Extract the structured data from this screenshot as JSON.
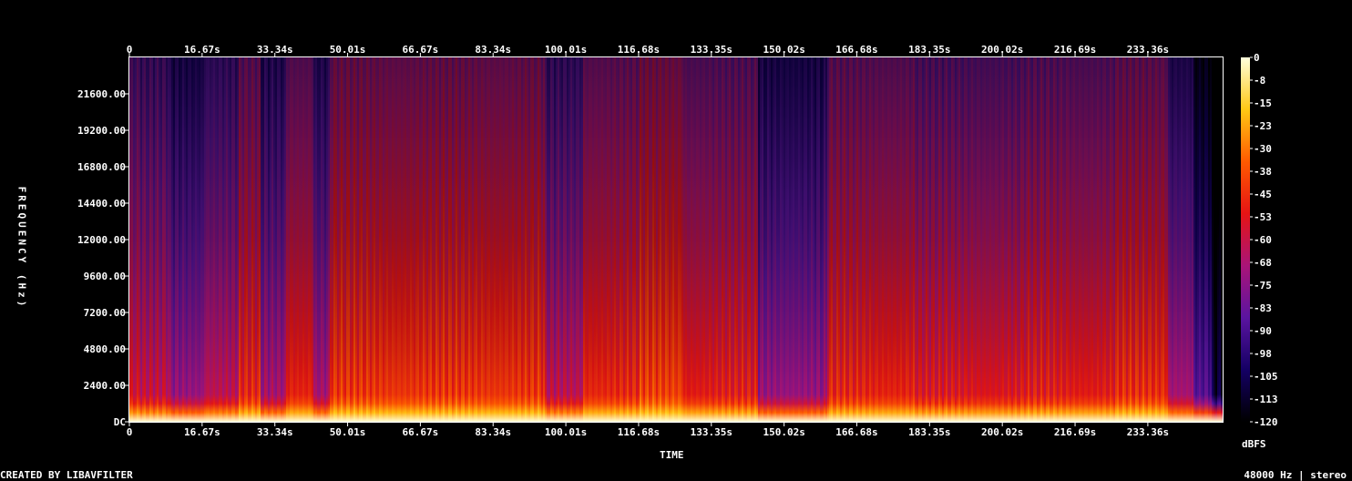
{
  "chart_data": {
    "type": "heatmap",
    "title": "",
    "xlabel": "TIME",
    "ylabel": "FREQUENCY (Hz)",
    "colorbar_label": "dBFS",
    "x_ticks": [
      "0",
      "16.67s",
      "33.34s",
      "50.01s",
      "66.67s",
      "83.34s",
      "100.01s",
      "116.68s",
      "133.35s",
      "150.02s",
      "166.68s",
      "183.35s",
      "200.02s",
      "216.69s",
      "233.36s"
    ],
    "x_tick_values": [
      0,
      16.67,
      33.34,
      50.01,
      66.67,
      83.34,
      100.01,
      116.68,
      133.35,
      150.02,
      166.68,
      183.35,
      200.02,
      216.69,
      233.36
    ],
    "xlim": [
      0,
      250.5
    ],
    "y_ticks": [
      "DC",
      "2400.00",
      "4800.00",
      "7200.00",
      "9600.00",
      "12000.00",
      "14400.00",
      "16800.00",
      "19200.00",
      "21600.00"
    ],
    "y_tick_values": [
      0,
      2400,
      4800,
      7200,
      9600,
      12000,
      14400,
      16800,
      19200,
      21600
    ],
    "ylim": [
      0,
      24000
    ],
    "colorbar_ticks": [
      "0",
      "-8",
      "-15",
      "-23",
      "-30",
      "-38",
      "-45",
      "-53",
      "-60",
      "-68",
      "-75",
      "-83",
      "-90",
      "-98",
      "-105",
      "-113",
      "-120"
    ],
    "colorbar_range": [
      -120,
      0
    ],
    "colormap": [
      "#000000",
      "#140064",
      "#5a14a0",
      "#aa1478",
      "#e61414",
      "#ff5a00",
      "#ffc814",
      "#ffffdc"
    ],
    "footer_left": "CREATED BY LIBAVFILTER",
    "footer_right": "48000 Hz | stereo",
    "segments": [
      {
        "t": [
          0,
          2.3
        ],
        "level": 0.55
      },
      {
        "t": [
          2.3,
          9
        ],
        "level": 0.52
      },
      {
        "t": [
          9,
          17
        ],
        "level": 0.42
      },
      {
        "t": [
          17,
          25
        ],
        "level": 0.5
      },
      {
        "t": [
          25,
          30
        ],
        "level": 0.62
      },
      {
        "t": [
          30,
          36
        ],
        "level": 0.45
      },
      {
        "t": [
          36,
          42
        ],
        "level": 0.62
      },
      {
        "t": [
          42,
          46
        ],
        "level": 0.45
      },
      {
        "t": [
          46,
          95
        ],
        "level": 0.66
      },
      {
        "t": [
          95,
          104
        ],
        "level": 0.5
      },
      {
        "t": [
          104,
          117
        ],
        "level": 0.63
      },
      {
        "t": [
          117,
          127
        ],
        "level": 0.68
      },
      {
        "t": [
          127,
          144
        ],
        "level": 0.6
      },
      {
        "t": [
          144,
          160
        ],
        "level": 0.42
      },
      {
        "t": [
          160,
          180
        ],
        "level": 0.62
      },
      {
        "t": [
          180,
          205
        ],
        "level": 0.58
      },
      {
        "t": [
          205,
          226
        ],
        "level": 0.6
      },
      {
        "t": [
          226,
          238
        ],
        "level": 0.64
      },
      {
        "t": [
          238,
          244
        ],
        "level": 0.45
      },
      {
        "t": [
          244,
          248
        ],
        "level": 0.3
      },
      {
        "t": [
          248,
          250.5
        ],
        "level": 0.1
      }
    ]
  }
}
